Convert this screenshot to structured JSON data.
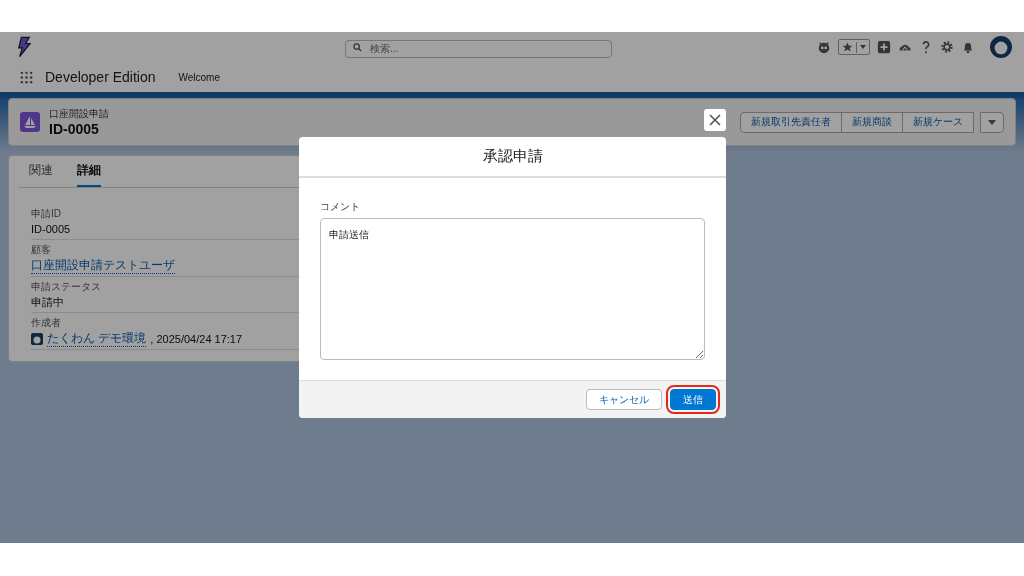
{
  "header": {
    "search": {
      "placeholder": "検索..."
    }
  },
  "nav": {
    "app_name": "Developer Edition",
    "items": [
      "Welcome"
    ]
  },
  "record": {
    "object": "口座開設申請",
    "title": "ID-0005",
    "actions": [
      "新規取引先責任者",
      "新規商談",
      "新規ケース"
    ]
  },
  "tabs": [
    {
      "label": "関連",
      "selected": false
    },
    {
      "label": "詳細",
      "selected": true
    }
  ],
  "fields": [
    {
      "label": "申請ID",
      "value": "ID-0005",
      "kind": "text"
    },
    {
      "label": "顧客",
      "value": "口座開設申請テストユーザ",
      "kind": "link"
    },
    {
      "label": "申請ステータス",
      "value": "申請中",
      "kind": "text"
    },
    {
      "label": "作成者",
      "value": "たくわん デモ環境",
      "suffix": ", 2025/04/24 17:17",
      "kind": "user"
    }
  ],
  "modal": {
    "title": "承認申請",
    "comment_label": "コメント",
    "comment": "申請送信",
    "buttons": [
      {
        "label": "キャンセル",
        "kind": "neutral",
        "highlighted": false
      },
      {
        "label": "送信",
        "kind": "brand",
        "highlighted": true
      }
    ]
  }
}
